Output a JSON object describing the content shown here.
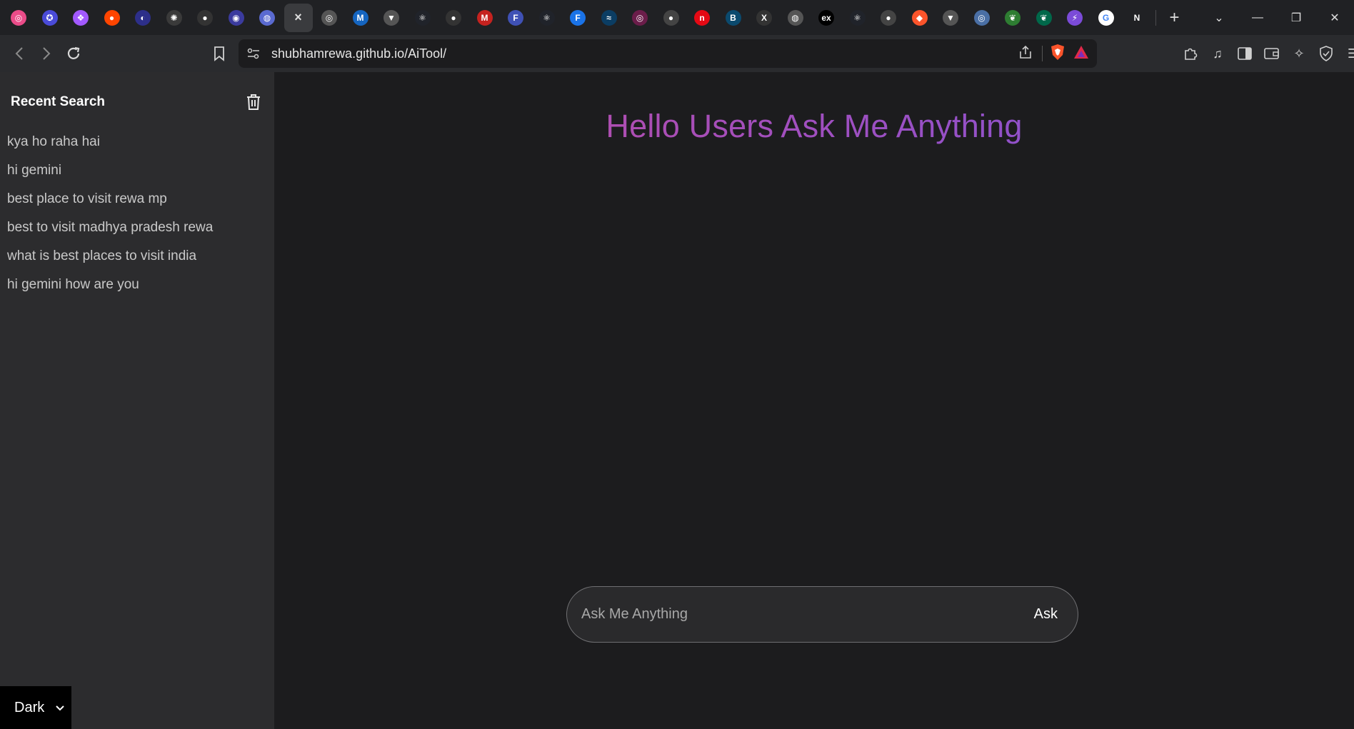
{
  "browser": {
    "tabs": [
      {
        "name": "dribbble-tab",
        "glyph": "◎",
        "color": "#ea4c89"
      },
      {
        "name": "react-hooks-tab",
        "glyph": "✪",
        "color": "#4a4bd8"
      },
      {
        "name": "figma-tab",
        "glyph": "❖",
        "color": "#a259ff"
      },
      {
        "name": "reddit-tab",
        "glyph": "●",
        "color": "#ff4500"
      },
      {
        "name": "dev-tab",
        "glyph": "◐",
        "color": "#2d2f8a"
      },
      {
        "name": "chatgpt-tab",
        "glyph": "✺",
        "color": "#3a3a3a"
      },
      {
        "name": "github-tab",
        "glyph": "●",
        "color": "#333333"
      },
      {
        "name": "app-tab",
        "glyph": "◉",
        "color": "#3b3b9e"
      },
      {
        "name": "gemini-tab",
        "glyph": "◍",
        "color": "#5a6ad0"
      },
      {
        "name": "current-tab",
        "glyph": "×",
        "color": "transparent"
      },
      {
        "name": "openai-tab",
        "glyph": "◎",
        "color": "#555555"
      },
      {
        "name": "mui-tab",
        "glyph": "M",
        "color": "#1565c0"
      },
      {
        "name": "vercel-tab",
        "glyph": "▼",
        "color": "#555555"
      },
      {
        "name": "react-docs-tab",
        "glyph": "⚛",
        "color": "#20232a"
      },
      {
        "name": "github-2-tab",
        "glyph": "●",
        "color": "#333333"
      },
      {
        "name": "gmail-tab",
        "glyph": "M",
        "color": "#c5221f"
      },
      {
        "name": "framer-tab",
        "glyph": "F",
        "color": "#3f51b5"
      },
      {
        "name": "react-tab",
        "glyph": "⚛",
        "color": "#20232a"
      },
      {
        "name": "form-tab",
        "glyph": "F",
        "color": "#1a73e8"
      },
      {
        "name": "tailwind-tab",
        "glyph": "≈",
        "color": "#0b3d63"
      },
      {
        "name": "tab-21",
        "glyph": "◎",
        "color": "#6b1d4a"
      },
      {
        "name": "avatar-tab",
        "glyph": "●",
        "color": "#444444"
      },
      {
        "name": "netflix-tab",
        "glyph": "n",
        "color": "#e50914"
      },
      {
        "name": "bootstrap-tab",
        "glyph": "B",
        "color": "#0b4a6e"
      },
      {
        "name": "x-tab",
        "glyph": "X",
        "color": "#333333"
      },
      {
        "name": "globe-tab",
        "glyph": "◍",
        "color": "#555555"
      },
      {
        "name": "express-tab",
        "glyph": "ex",
        "color": "#000000"
      },
      {
        "name": "react-2-tab",
        "glyph": "⚛",
        "color": "#20232a"
      },
      {
        "name": "profile-tab",
        "glyph": "●",
        "color": "#444444"
      },
      {
        "name": "brave-tab",
        "glyph": "◆",
        "color": "#fb542b"
      },
      {
        "name": "vercel-2-tab",
        "glyph": "▼",
        "color": "#555555"
      },
      {
        "name": "tab-32",
        "glyph": "◎",
        "color": "#4a6fa5"
      },
      {
        "name": "mongodb-tab",
        "glyph": "❦",
        "color": "#2e7d32"
      },
      {
        "name": "mongodb-2-tab",
        "glyph": "❦",
        "color": "#00684a"
      },
      {
        "name": "vite-tab",
        "glyph": "⚡",
        "color": "#7b4bd8"
      },
      {
        "name": "google-tab",
        "glyph": "G",
        "color": "#ffffff"
      },
      {
        "name": "notion-tab",
        "glyph": "N",
        "color": "transparent"
      }
    ],
    "url": "shubhamrewa.github.io/AiTool/"
  },
  "sidebar": {
    "title": "Recent Search",
    "history": [
      "kya ho raha hai",
      "hi gemini",
      "best place to visit rewa mp",
      "best to visit madhya pradesh rewa",
      "what is best places to visit india",
      "hi gemini how are you"
    ],
    "theme": "Dark"
  },
  "main": {
    "heading": "Hello Users Ask Me Anything",
    "input_placeholder": "Ask Me Anything",
    "ask_label": "Ask"
  }
}
